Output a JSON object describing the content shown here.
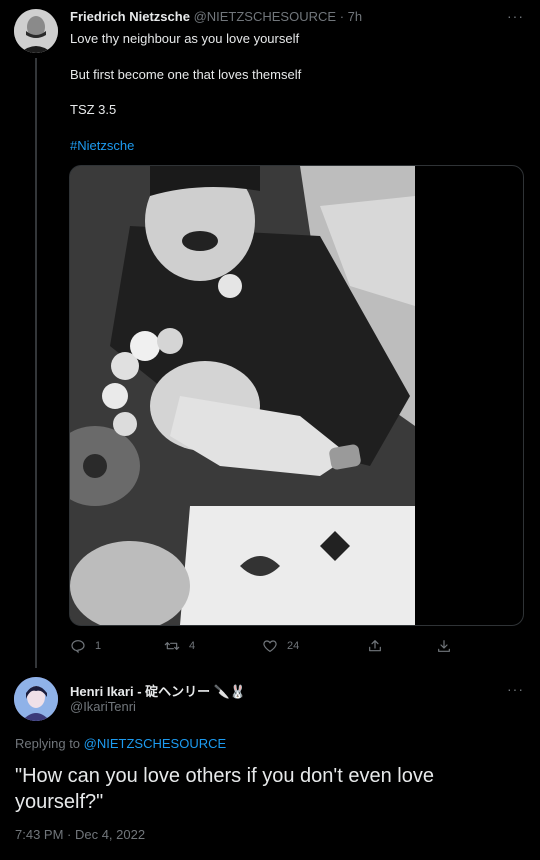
{
  "tweet": {
    "author_name": "Friedrich Nietzsche",
    "author_handle": "@NIETZSCHESOURCE",
    "time_ago": "· 7h",
    "more_label": "···",
    "lines": [
      "Love thy neighbour as you love yourself",
      "But first become one that loves themself",
      "TSZ 3.5"
    ],
    "hashtag": "#Nietzsche",
    "actions": {
      "reply_count": "1",
      "retweet_count": "4",
      "like_count": "24"
    }
  },
  "reply": {
    "author_name": "Henri Ikari - 碇ヘンリー 🔪🐰",
    "author_handle": "@IkariTenri",
    "more_label": "···",
    "replying_prefix": "Replying to",
    "replying_to": "@NIETZSCHESOURCE",
    "text": "\"How can you love others if you don't even love yourself?\"",
    "timestamp": "7:43 PM · Dec 4, 2022"
  },
  "colors": {
    "background": "#000000",
    "text": "#e7e9ea",
    "muted": "#71767b",
    "accent": "#1d9bf0",
    "border": "#2f3336"
  },
  "icons": [
    "reply-icon",
    "retweet-icon",
    "like-icon",
    "share-icon",
    "download-icon",
    "more-icon"
  ]
}
